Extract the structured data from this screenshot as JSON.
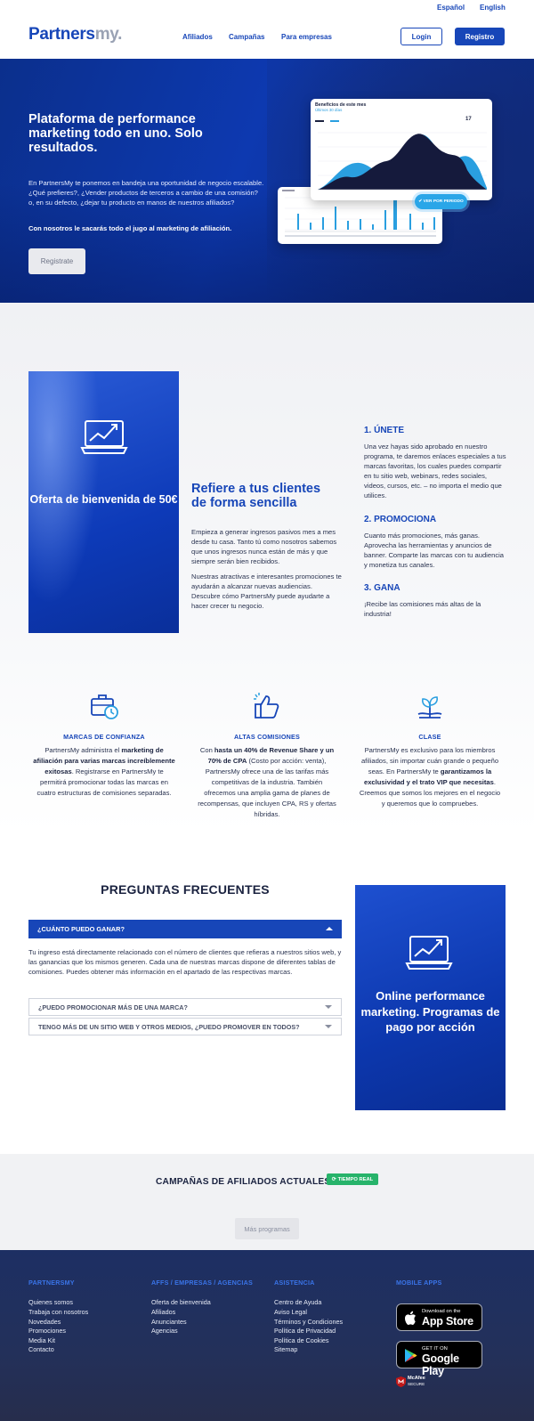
{
  "header": {
    "lang_es": "Español",
    "lang_en": "English",
    "logo_main": "Partners",
    "logo_suffix": "my.",
    "nav": [
      "Afiliados",
      "Campañas",
      "Para empresas"
    ],
    "login": "Login",
    "register": "Registro"
  },
  "hero": {
    "title": "Plataforma de performance marketing todo en uno. Solo resultados.",
    "text": "En PartnersMy te ponemos en bandeja una oportunidad de negocio escalable. ¿Qué prefieres?, ¿Vender productos de terceros a cambio de una comisión? o, en su defecto, ¿dejar tu producto en manos de nuestros afiliados?",
    "strong": "Con nosotros le sacarás todo el jugo al marketing de afiliación.",
    "button": "Registrate",
    "card_title": "Beneficios de este mes",
    "card_sub": "Últimos 30 días",
    "card_num": "17",
    "card_btn": "✔ VER POR PERIODO"
  },
  "refiere": {
    "promo": "Oferta de bienvenida de 50€",
    "title": "Refiere a tus clientes de forma sencilla",
    "p1": "Empieza a generar ingresos pasivos mes a mes desde tu casa. Tanto tú como nosotros sabemos que unos ingresos nunca están de más y que siempre serán bien recibidos.",
    "p2": "Nuestras atractivas e interesantes promociones te ayudarán a alcanzar nuevas audiencias. Descubre cómo PartnersMy puede ayudarte a hacer crecer tu negocio.",
    "steps": [
      {
        "title": "1. ÚNETE",
        "text": "Una vez hayas sido aprobado en nuestro programa, te daremos enlaces especiales a tus marcas favoritas, los cuales puedes compartir en tu sitio web, webinars, redes sociales, videos, cursos, etc. – no importa el medio que utilices."
      },
      {
        "title": "2. PROMOCIONA",
        "text": "Cuanto más promociones, más ganas. Aprovecha las herramientas y anuncios de banner. Comparte las marcas con tu audiencia y monetiza tus canales."
      },
      {
        "title": "3. GANA",
        "text": "¡Recibe las comisiones más altas de la industria!"
      }
    ]
  },
  "features": [
    {
      "icon": "briefcase-clock-icon",
      "title": "MARCAS DE CONFIANZA",
      "t1": "PartnersMy administra el ",
      "b1": "marketing de afiliación para varias marcas increíblemente exitosas",
      "t2": ". Registrarse en PartnersMy te permitirá promocionar todas las marcas en cuatro estructuras de comisiones separadas."
    },
    {
      "icon": "thumbs-up-icon",
      "title": "ALTAS COMISIONES",
      "t1": "Con ",
      "b1": "hasta un 40% de Revenue Share y un 70% de CPA",
      "t2": " (Costo por acción: venta), PartnersMy ofrece una de las tarifas más competitivas de la industria. También ofrecemos una amplia gama de planes de recompensas, que incluyen CPA, RS y ofertas híbridas."
    },
    {
      "icon": "growing-plant-icon",
      "title": "CLASE",
      "t1": "PartnersMy es exclusivo para los miembros afiliados, sin importar cuán grande o pequeño seas. En PartnersMy te ",
      "b1": "garantizamos la exclusividad y el trato VIP que necesitas",
      "t2": ". Creemos que somos los mejores en el negocio y queremos que lo compruebes."
    }
  ],
  "faq": {
    "title": "PREGUNTAS FRECUENTES",
    "open_q": "¿CUÁNTO PUEDO GANAR?",
    "answer": "Tu ingreso está directamente relacionado con el número de clientes que refieras a nuestros sitios web, y las ganancias que los mismos generen. Cada una de nuestras marcas dispone de diferentes tablas de comisiones. Puedes obtener más información en el apartado de las respectivas marcas.",
    "q2": "¿PUEDO PROMOCIONAR MÁS DE UNA MARCA?",
    "q3": "TENGO MÁS DE UN SITIO WEB Y OTROS MEDIOS, ¿PUEDO PROMOVER EN TODOS?",
    "online": "Online performance marketing. Programas de pago por acción"
  },
  "campaigns": {
    "title": "CAMPAÑAS DE AFILIADOS ACTUALES",
    "badge": "TIEMPO REAL",
    "more": "Más programas"
  },
  "footer": {
    "col1": {
      "title": "PARTNERSMY",
      "links": [
        "Quienes somos",
        "Trabaja con nosotros",
        "Novedades",
        "Promociones",
        "Media Kit",
        "Contacto"
      ]
    },
    "col2": {
      "title": "AFFS / EMPRESAS / AGENCIAS",
      "links": [
        "Oferta de bienvenida",
        "Afiliados",
        "Anunciantes",
        "Agencias"
      ]
    },
    "col3": {
      "title": "ASISTENCIA",
      "links": [
        "Centro de Ayuda",
        "Aviso Legal",
        "Términos y Condiciones",
        "Política de Privacidad",
        "Política de Cookies",
        "Sitemap"
      ]
    },
    "col4": {
      "title": "MOBILE APPS"
    },
    "appstore_small": "Download on the",
    "appstore_big": "App Store",
    "gplay_small": "GET IT ON",
    "gplay_big": "Google Play",
    "mcafee": "McAfee",
    "mcafee_sub": "SECURE"
  },
  "colors": {
    "brand": "#1746b8",
    "footer": "#23305a",
    "badge": "#27b36a"
  }
}
